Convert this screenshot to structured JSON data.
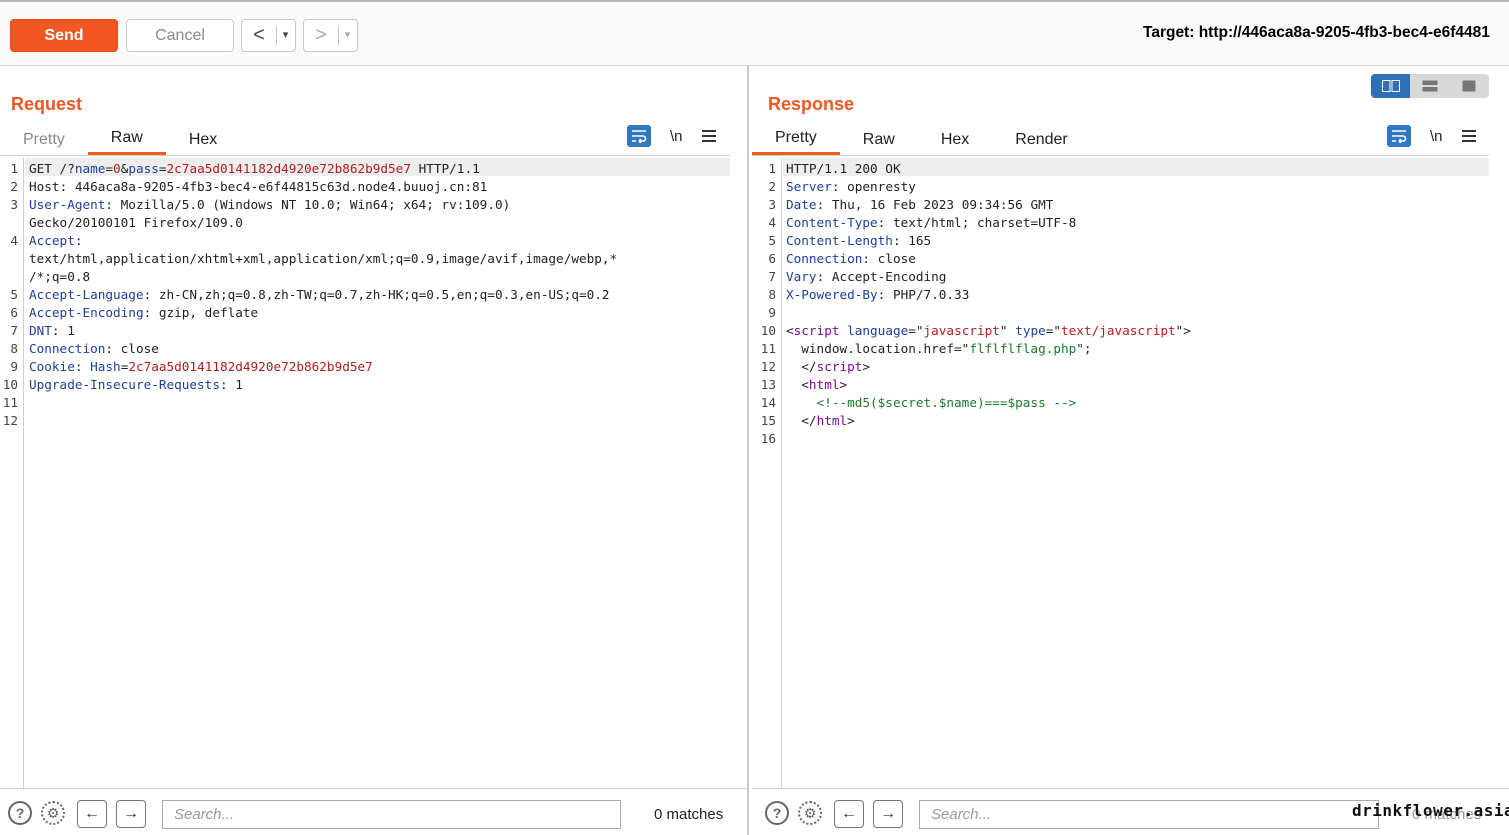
{
  "toolbar": {
    "send_label": "Send",
    "cancel_label": "Cancel",
    "back_label": "<",
    "forward_label": ">",
    "dropdown_glyph": "▾",
    "target_text": "Target: http://446aca8a-9205-4fb3-bec4-e6f4481"
  },
  "request": {
    "title": "Request",
    "tabs": [
      "Pretty",
      "Raw",
      "Hex"
    ],
    "active_tab": "Raw",
    "newline_label": "\\n",
    "lines": [
      {
        "n": "1",
        "parts": [
          [
            "GET /?",
            ""
          ],
          [
            "name",
            "k"
          ],
          [
            "=",
            ""
          ],
          [
            "0",
            "v"
          ],
          [
            "&",
            ""
          ],
          [
            "pass",
            "k"
          ],
          [
            "=",
            ""
          ],
          [
            "2c7aa5d0141182d4920e72b862b9d5e7",
            "v"
          ],
          [
            " HTTP/1.1",
            ""
          ]
        ]
      },
      {
        "n": "2",
        "parts": [
          [
            "Host",
            ""
          ],
          [
            ": 446aca8a-9205-4fb3-bec4-e6f44815c63d.node4.buuoj.cn:81",
            ""
          ]
        ]
      },
      {
        "n": "3",
        "parts": [
          [
            "User-Agent",
            "k"
          ],
          [
            ": Mozilla/5.0 (Windows NT 10.0; Win64; x64; rv:109.0)",
            ""
          ]
        ]
      },
      {
        "n": "",
        "parts": [
          [
            "Gecko/20100101 Firefox/109.0",
            ""
          ]
        ]
      },
      {
        "n": "4",
        "parts": [
          [
            "Accept",
            "k"
          ],
          [
            ":",
            ""
          ]
        ]
      },
      {
        "n": "",
        "parts": [
          [
            "text/html,application/xhtml+xml,application/xml;q=0.9,image/avif,image/webp,*",
            ""
          ]
        ]
      },
      {
        "n": "",
        "parts": [
          [
            "/*;q=0.8",
            ""
          ]
        ]
      },
      {
        "n": "5",
        "parts": [
          [
            "Accept-Language",
            "k"
          ],
          [
            ": zh-CN,zh;q=0.8,zh-TW;q=0.7,zh-HK;q=0.5,en;q=0.3,en-US;q=0.2",
            ""
          ]
        ]
      },
      {
        "n": "6",
        "parts": [
          [
            "Accept-Encoding",
            "k"
          ],
          [
            ": gzip, deflate",
            ""
          ]
        ]
      },
      {
        "n": "7",
        "parts": [
          [
            "DNT",
            "k"
          ],
          [
            ": 1",
            ""
          ]
        ]
      },
      {
        "n": "8",
        "parts": [
          [
            "Connection",
            "k"
          ],
          [
            ": close",
            ""
          ]
        ]
      },
      {
        "n": "9",
        "parts": [
          [
            "Cookie",
            "k"
          ],
          [
            ": ",
            ""
          ],
          [
            "Hash",
            "k"
          ],
          [
            "=",
            ""
          ],
          [
            "2c7aa5d0141182d4920e72b862b9d5e7",
            "v"
          ]
        ]
      },
      {
        "n": "10",
        "parts": [
          [
            "Upgrade-Insecure-Requests",
            "k"
          ],
          [
            ": 1",
            ""
          ]
        ]
      },
      {
        "n": "11",
        "parts": []
      },
      {
        "n": "12",
        "parts": []
      }
    ],
    "search_placeholder": "Search...",
    "matches": "0 matches"
  },
  "response": {
    "title": "Response",
    "tabs": [
      "Pretty",
      "Raw",
      "Hex",
      "Render"
    ],
    "active_tab": "Pretty",
    "newline_label": "\\n",
    "lines": [
      {
        "n": "1",
        "parts": [
          [
            "HTTP/1.1 200 OK",
            ""
          ]
        ]
      },
      {
        "n": "2",
        "parts": [
          [
            "Server",
            "k"
          ],
          [
            ": openresty",
            ""
          ]
        ]
      },
      {
        "n": "3",
        "parts": [
          [
            "Date",
            "k"
          ],
          [
            ": Thu, 16 Feb 2023 09:34:56 GMT",
            ""
          ]
        ]
      },
      {
        "n": "4",
        "parts": [
          [
            "Content-Type",
            "k"
          ],
          [
            ": text/html; charset=UTF-8",
            ""
          ]
        ]
      },
      {
        "n": "5",
        "parts": [
          [
            "Content-Length",
            "k"
          ],
          [
            ": 165",
            ""
          ]
        ]
      },
      {
        "n": "6",
        "parts": [
          [
            "Connection",
            "k"
          ],
          [
            ": close",
            ""
          ]
        ]
      },
      {
        "n": "7",
        "parts": [
          [
            "Vary",
            "k"
          ],
          [
            ": Accept-Encoding",
            ""
          ]
        ]
      },
      {
        "n": "8",
        "parts": [
          [
            "X-Powered-By",
            "k"
          ],
          [
            ": PHP/7.0.33",
            ""
          ]
        ]
      },
      {
        "n": "9",
        "parts": []
      },
      {
        "n": "10",
        "parts": [
          [
            "<",
            ""
          ],
          [
            "script",
            "t"
          ],
          [
            " ",
            ""
          ],
          [
            "language",
            "k"
          ],
          [
            "=\"",
            ""
          ],
          [
            "javascript",
            "v"
          ],
          [
            "\" ",
            ""
          ],
          [
            "type",
            "k"
          ],
          [
            "=\"",
            ""
          ],
          [
            "text/javascript",
            "v"
          ],
          [
            "\">",
            ""
          ]
        ]
      },
      {
        "n": "11",
        "parts": [
          [
            "  window.location.href=\"",
            ""
          ],
          [
            "flflflflag.php",
            "s"
          ],
          [
            "\";",
            ""
          ]
        ]
      },
      {
        "n": "12",
        "parts": [
          [
            "  </",
            ""
          ],
          [
            "script",
            "t"
          ],
          [
            ">",
            ""
          ]
        ]
      },
      {
        "n": "13",
        "parts": [
          [
            "  <",
            ""
          ],
          [
            "html",
            "t"
          ],
          [
            ">",
            ""
          ]
        ]
      },
      {
        "n": "14",
        "parts": [
          [
            "    <!--md5($secret.$name)===$pass -->",
            "s"
          ]
        ]
      },
      {
        "n": "15",
        "parts": [
          [
            "  </",
            ""
          ],
          [
            "html",
            "t"
          ],
          [
            ">",
            ""
          ]
        ]
      },
      {
        "n": "16",
        "parts": []
      }
    ],
    "search_placeholder": "Search...",
    "matches": "0 matches",
    "watermark": "drinkflower.asia"
  }
}
